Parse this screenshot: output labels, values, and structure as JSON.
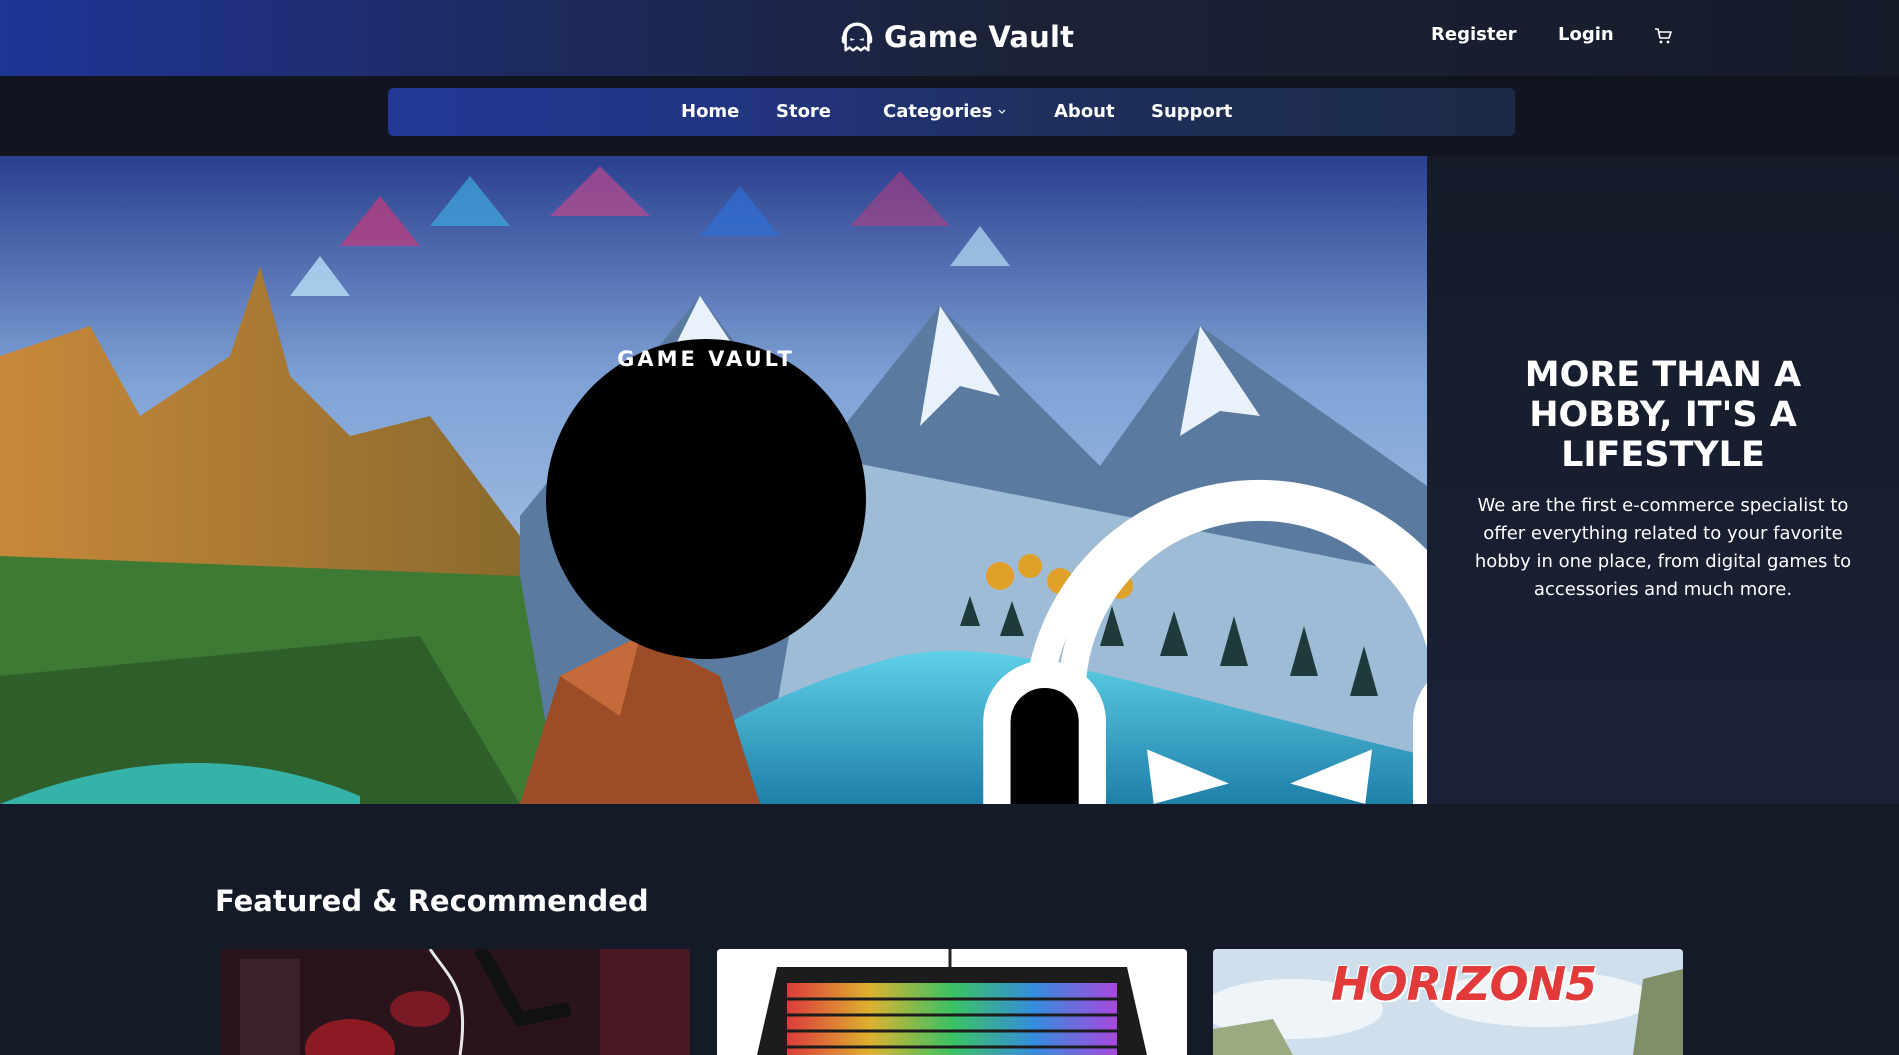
{
  "header": {
    "brand_name": "Game Vault",
    "register_label": "Register",
    "login_label": "Login",
    "cart_icon": "cart-icon"
  },
  "nav": {
    "items": [
      {
        "label": "Home"
      },
      {
        "label": "Store"
      },
      {
        "label": "Categories"
      },
      {
        "label": "About"
      },
      {
        "label": "Support"
      }
    ]
  },
  "hero": {
    "logo_text": "GAME VAULT",
    "heading": "MORE THAN A HOBBY, IT'S A LIFESTYLE",
    "description": "We are the first e-commerce specialist to offer everything related to your favorite hobby in one place, from digital games to accessories and much more."
  },
  "featured": {
    "title": "Featured & Recommended",
    "cards": [
      {
        "image": "spider-man-game-cover"
      },
      {
        "image": "rgb-keyboard"
      },
      {
        "image": "forza-horizon-5-cover",
        "title_art": "HORIZON5"
      }
    ]
  },
  "colors": {
    "header_gradient_start": "#1f3597",
    "page_background": "#141a28",
    "nav_background": "#223582"
  }
}
